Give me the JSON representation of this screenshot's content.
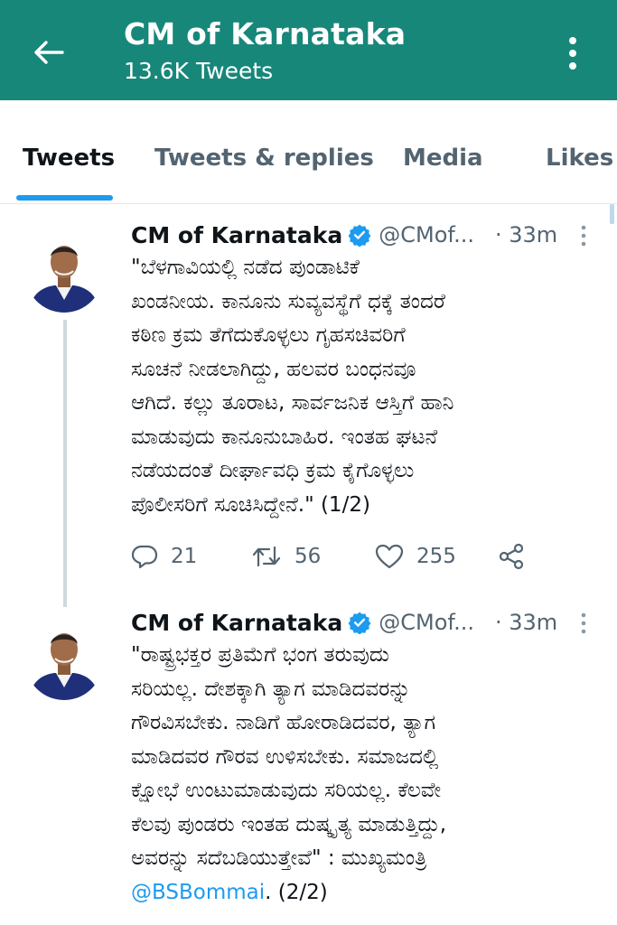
{
  "header": {
    "title": "CM of Karnataka",
    "subtitle": "13.6K Tweets",
    "back_icon": "arrow-left-icon",
    "more_icon": "vertical-dots-icon",
    "background": "#17877a"
  },
  "tabs": [
    {
      "label": "Tweets",
      "active": true
    },
    {
      "label": "Tweets & replies",
      "active": false
    },
    {
      "label": "Media",
      "active": false
    },
    {
      "label": "Likes",
      "active": false
    }
  ],
  "accent": "#1d9bf0",
  "tweets": [
    {
      "name": "CM of Karnataka",
      "handle": "@CMof...",
      "time": "· 33m",
      "lines": [
        "\"ಬೆಳಗಾವಿಯಲ್ಲಿ ನಡೆದ ಪುಂಡಾಟಿಕೆ",
        "ಖಂಡನೀಯ. ಕಾನೂನು ಸುವ್ಯವಸ್ಥೆಗೆ ಧಕ್ಕೆ ತಂದರೆ",
        "ಕಠಿಣ ಕ್ರಮ ತೆಗೆದುಕೊಳ್ಳಲು ಗೃಹಸಚಿವರಿಗೆ",
        "ಸೂಚನೆ ನೀಡಲಾಗಿದ್ದು, ಹಲವರ ಬಂಧನವೂ",
        "ಆಗಿದೆ. ಕಲ್ಲು ತೂರಾಟ, ಸಾರ್ವಜನಿಕ ಆಸ್ತಿಗೆ ಹಾನಿ",
        "ಮಾಡುವುದು ಕಾನೂನುಬಾಹಿರ. ಇಂತಹ ಘಟನೆ",
        "ನಡೆಯದಂತೆ ದೀರ್ಘಾವಧಿ ಕ್ರಮ ಕೈಗೊಳ್ಳಲು",
        "ಪೊಲೀಸರಿಗೆ ಸೂಚಿಸಿದ್ದೇನೆ.\" (1/2)"
      ],
      "replies": "21",
      "retweets": "56",
      "likes": "255"
    },
    {
      "name": "CM of Karnataka",
      "handle": "@CMof...",
      "time": "· 33m",
      "lines": [
        "\"ರಾಷ್ಟ್ರಭಕ್ತರ ಪ್ರತಿಮೆಗೆ ಭಂಗ ತರುವುದು",
        "ಸರಿಯಲ್ಲ. ದೇಶಕ್ಕಾಗಿ ತ್ಯಾಗ ಮಾಡಿದವರನ್ನು",
        "ಗೌರವಿಸಬೇಕು. ನಾಡಿಗೆ ಹೋರಾಡಿದವರ, ತ್ಯಾಗ",
        "ಮಾಡಿದವರ ಗೌರವ ಉಳಿಸಬೇಕು. ಸಮಾಜದಲ್ಲಿ",
        "ಕ್ಷೋಭೆ ಉಂಟುಮಾಡುವುದು ಸರಿಯಲ್ಲ. ಕೆಲವೇ",
        "ಕೆಲವು ಪುಂಡರು ಇಂತಹ ದುಷ್ಕೃತ್ಯ ಮಾಡುತ್ತಿದ್ದು,",
        "ಅವರನ್ನು ಸದೆಬಡಿಯುತ್ತೇವೆ\" : ಮುಖ್ಯಮಂತ್ರಿ"
      ],
      "mention": "@BSBommai",
      "tail": ". (2/2)"
    }
  ]
}
